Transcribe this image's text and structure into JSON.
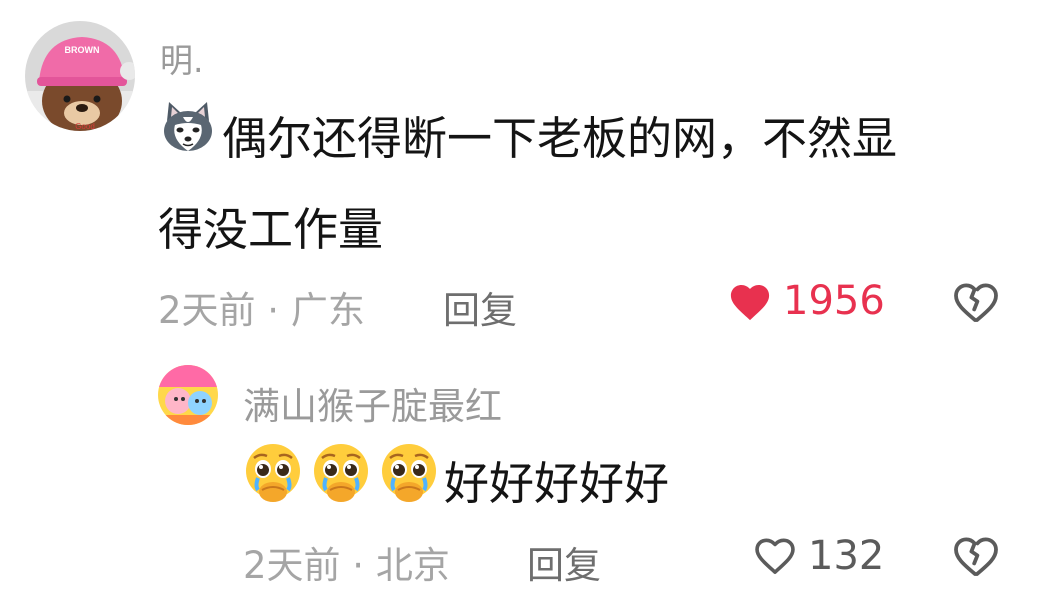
{
  "comments": [
    {
      "username": "明.",
      "avatar_badge": "BROWN",
      "emoji": "husky-dog-emoji",
      "text_line1": "偶尔还得断一下老板的网，不然显",
      "text_line2": "得没工作量",
      "time_location": "2天前 · 广东",
      "reply_label": "回复",
      "liked": true,
      "like_count": "1956",
      "like_color": "#e8314f"
    },
    {
      "username": "满山猴子腚最红",
      "emoji": "pleading-face-emoji",
      "emoji_repeat": 3,
      "text": "好好好好好",
      "time_location": "2天前 · 北京",
      "reply_label": "回复",
      "liked": false,
      "like_count": "132"
    }
  ]
}
